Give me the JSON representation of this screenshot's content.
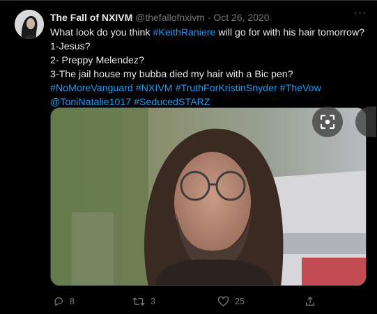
{
  "tweet": {
    "author_name": "The Fall of NXIVM",
    "handle": "@thefallofnxivm",
    "separator": "·",
    "date": "Oct 26, 2020",
    "more_icon": "more-horizontal-icon",
    "text": {
      "line1_prefix": "What look do you think ",
      "line1_tag": "#KeithRaniere",
      "line1_suffix": " will go for with his hair tomorrow?",
      "line2": "1-Jesus?",
      "line3": "2- Preppy Melendez?",
      "line4": "3-The jail house my bubba died my hair with a Bic pen?",
      "line5_tags": [
        "#NoMoreVanguard",
        "#NXIVM",
        "#TruthForKristinSnyder",
        "#TheVow"
      ],
      "line6_tags": [
        "@ToniNatalie1017",
        "#SeducedSTARZ"
      ]
    },
    "media": {
      "image_icon": "photo-of-man-with-long-hair-and-glasses",
      "lens_icon": "lens-search-icon"
    },
    "actions": {
      "reply_count": "8",
      "retweet_count": "3",
      "like_count": "25",
      "reply_icon": "reply-icon",
      "retweet_icon": "retweet-icon",
      "like_icon": "heart-icon",
      "share_icon": "share-icon"
    }
  },
  "colors": {
    "background": "#000000",
    "text": "#e7e9ea",
    "muted": "#71767b",
    "link": "#1d9bf0"
  }
}
